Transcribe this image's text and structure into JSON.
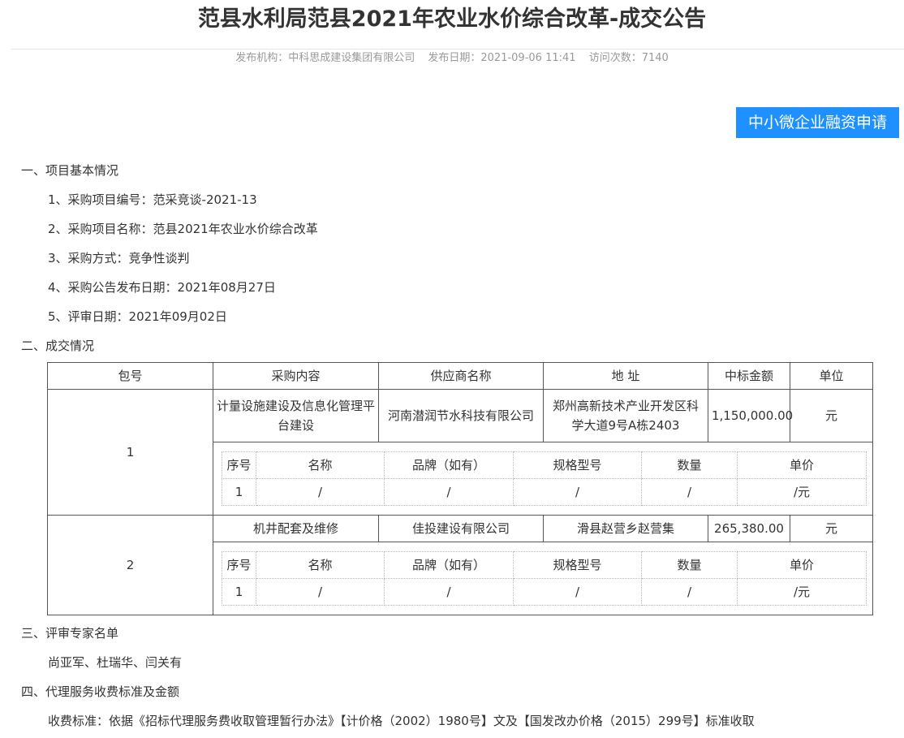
{
  "title": "范县水利局范县2021年农业水价综合改革-成交公告",
  "meta": {
    "org_label": "发布机构：",
    "org": "中科思成建设集团有限公司",
    "date_label": "发布日期：",
    "date": "2021-09-06 11:41",
    "visits_label": "访问次数：",
    "visits": "7140"
  },
  "finance_button": "中小微企业融资申请",
  "section1": {
    "heading": "一、项目基本情况",
    "items": [
      "1、采购项目编号：范采竞谈-2021-13",
      "2、采购项目名称：范县2021年农业水价综合改革",
      "3、采购方式：竞争性谈判",
      "4、采购公告发布日期：2021年08月27日",
      "5、评审日期：2021年09月02日"
    ]
  },
  "section2": {
    "heading": "二、成交情况"
  },
  "table": {
    "headers": [
      "包号",
      "采购内容",
      "供应商名称",
      "地 址",
      "中标金额",
      "单位"
    ],
    "sub_headers": [
      "序号",
      "名称",
      "品牌（如有）",
      "规格型号",
      "数量",
      "单价"
    ],
    "packages": [
      {
        "no": "1",
        "content": "计量设施建设及信息化管理平台建设",
        "supplier": "河南潜润节水科技有限公司",
        "address": "郑州高新技术产业开发区科学大道9号A栋2403",
        "amount": "1,150,000.00",
        "unit": "元",
        "sub_row": [
          "1",
          "/",
          "/",
          "/",
          "/",
          "/元"
        ]
      },
      {
        "no": "2",
        "content": "机井配套及维修",
        "supplier": "佳投建设有限公司",
        "address": "滑县赵营乡赵营集",
        "amount": "265,380.00",
        "unit": "元",
        "sub_row": [
          "1",
          "/",
          "/",
          "/",
          "/",
          "/元"
        ]
      }
    ]
  },
  "section3": {
    "heading": "三、评审专家名单",
    "text": "尚亚军、杜瑞华、闫关有"
  },
  "section4": {
    "heading": "四、代理服务收费标准及金额",
    "text": "收费标准：依据《招标代理服务费收取管理暂行办法》【计价格（2002）1980号】文及【国发改办价格（2015）299号】标准收取"
  }
}
